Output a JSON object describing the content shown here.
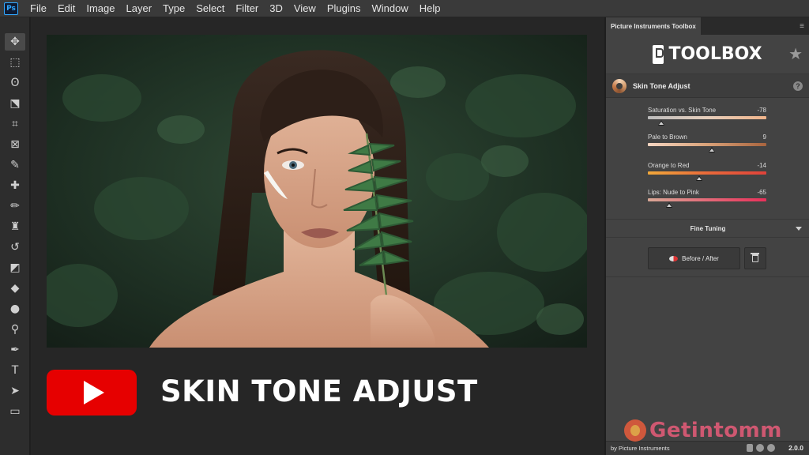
{
  "app": {
    "logo_text": "Ps"
  },
  "menu": [
    "File",
    "Edit",
    "Image",
    "Layer",
    "Type",
    "Select",
    "Filter",
    "3D",
    "View",
    "Plugins",
    "Window",
    "Help"
  ],
  "tools": [
    {
      "name": "move-tool",
      "glyph": "✥"
    },
    {
      "name": "marquee-tool",
      "glyph": "⬚"
    },
    {
      "name": "lasso-tool",
      "glyph": "ʘ"
    },
    {
      "name": "object-selection-tool",
      "glyph": "⬔"
    },
    {
      "name": "crop-tool",
      "glyph": "⌗"
    },
    {
      "name": "frame-tool",
      "glyph": "⊠"
    },
    {
      "name": "eyedropper-tool",
      "glyph": "✎"
    },
    {
      "name": "healing-brush-tool",
      "glyph": "✚"
    },
    {
      "name": "brush-tool",
      "glyph": "✏"
    },
    {
      "name": "clone-stamp-tool",
      "glyph": "♜"
    },
    {
      "name": "history-brush-tool",
      "glyph": "↺"
    },
    {
      "name": "eraser-tool",
      "glyph": "◩"
    },
    {
      "name": "paint-bucket-tool",
      "glyph": "◆"
    },
    {
      "name": "blur-tool",
      "glyph": "●"
    },
    {
      "name": "dodge-tool",
      "glyph": "⚲"
    },
    {
      "name": "pen-tool",
      "glyph": "✒"
    },
    {
      "name": "type-tool",
      "glyph": "T"
    },
    {
      "name": "path-selection-tool",
      "glyph": "➤"
    },
    {
      "name": "rectangle-tool",
      "glyph": "▭"
    }
  ],
  "video": {
    "title": "SKIN TONE ADJUST"
  },
  "panel": {
    "tab_title": "Picture Instruments Toolbox",
    "menu_icon": "≡",
    "brand": "TOOLBOX",
    "star_icon": "★",
    "module_title": "Skin Tone Adjust",
    "help": "?",
    "sliders": [
      {
        "label": "Saturation vs. Skin Tone",
        "value": "-78",
        "position": 0.11,
        "gradient": "linear-gradient(90deg,#bcbcbc,#e5cdbb,#f0b48a)"
      },
      {
        "label": "Pale to Brown",
        "value": "9",
        "position": 0.54,
        "gradient": "linear-gradient(90deg,#f5d6c2,#d9a279,#a8643e)"
      },
      {
        "label": "Orange to Red",
        "value": "-14",
        "position": 0.43,
        "gradient": "linear-gradient(90deg,#f2a83a,#e96a3a,#e0423a)"
      },
      {
        "label": "Lips: Nude to Pink",
        "value": "-65",
        "position": 0.18,
        "gradient": "linear-gradient(90deg,#d9a896,#e36a78,#e8305a)"
      }
    ],
    "fine_tuning": "Fine Tuning",
    "before_after": "Before / After",
    "footer_credit": "by Picture Instruments",
    "version": "2.0.0"
  },
  "watermark": "Getintomm"
}
